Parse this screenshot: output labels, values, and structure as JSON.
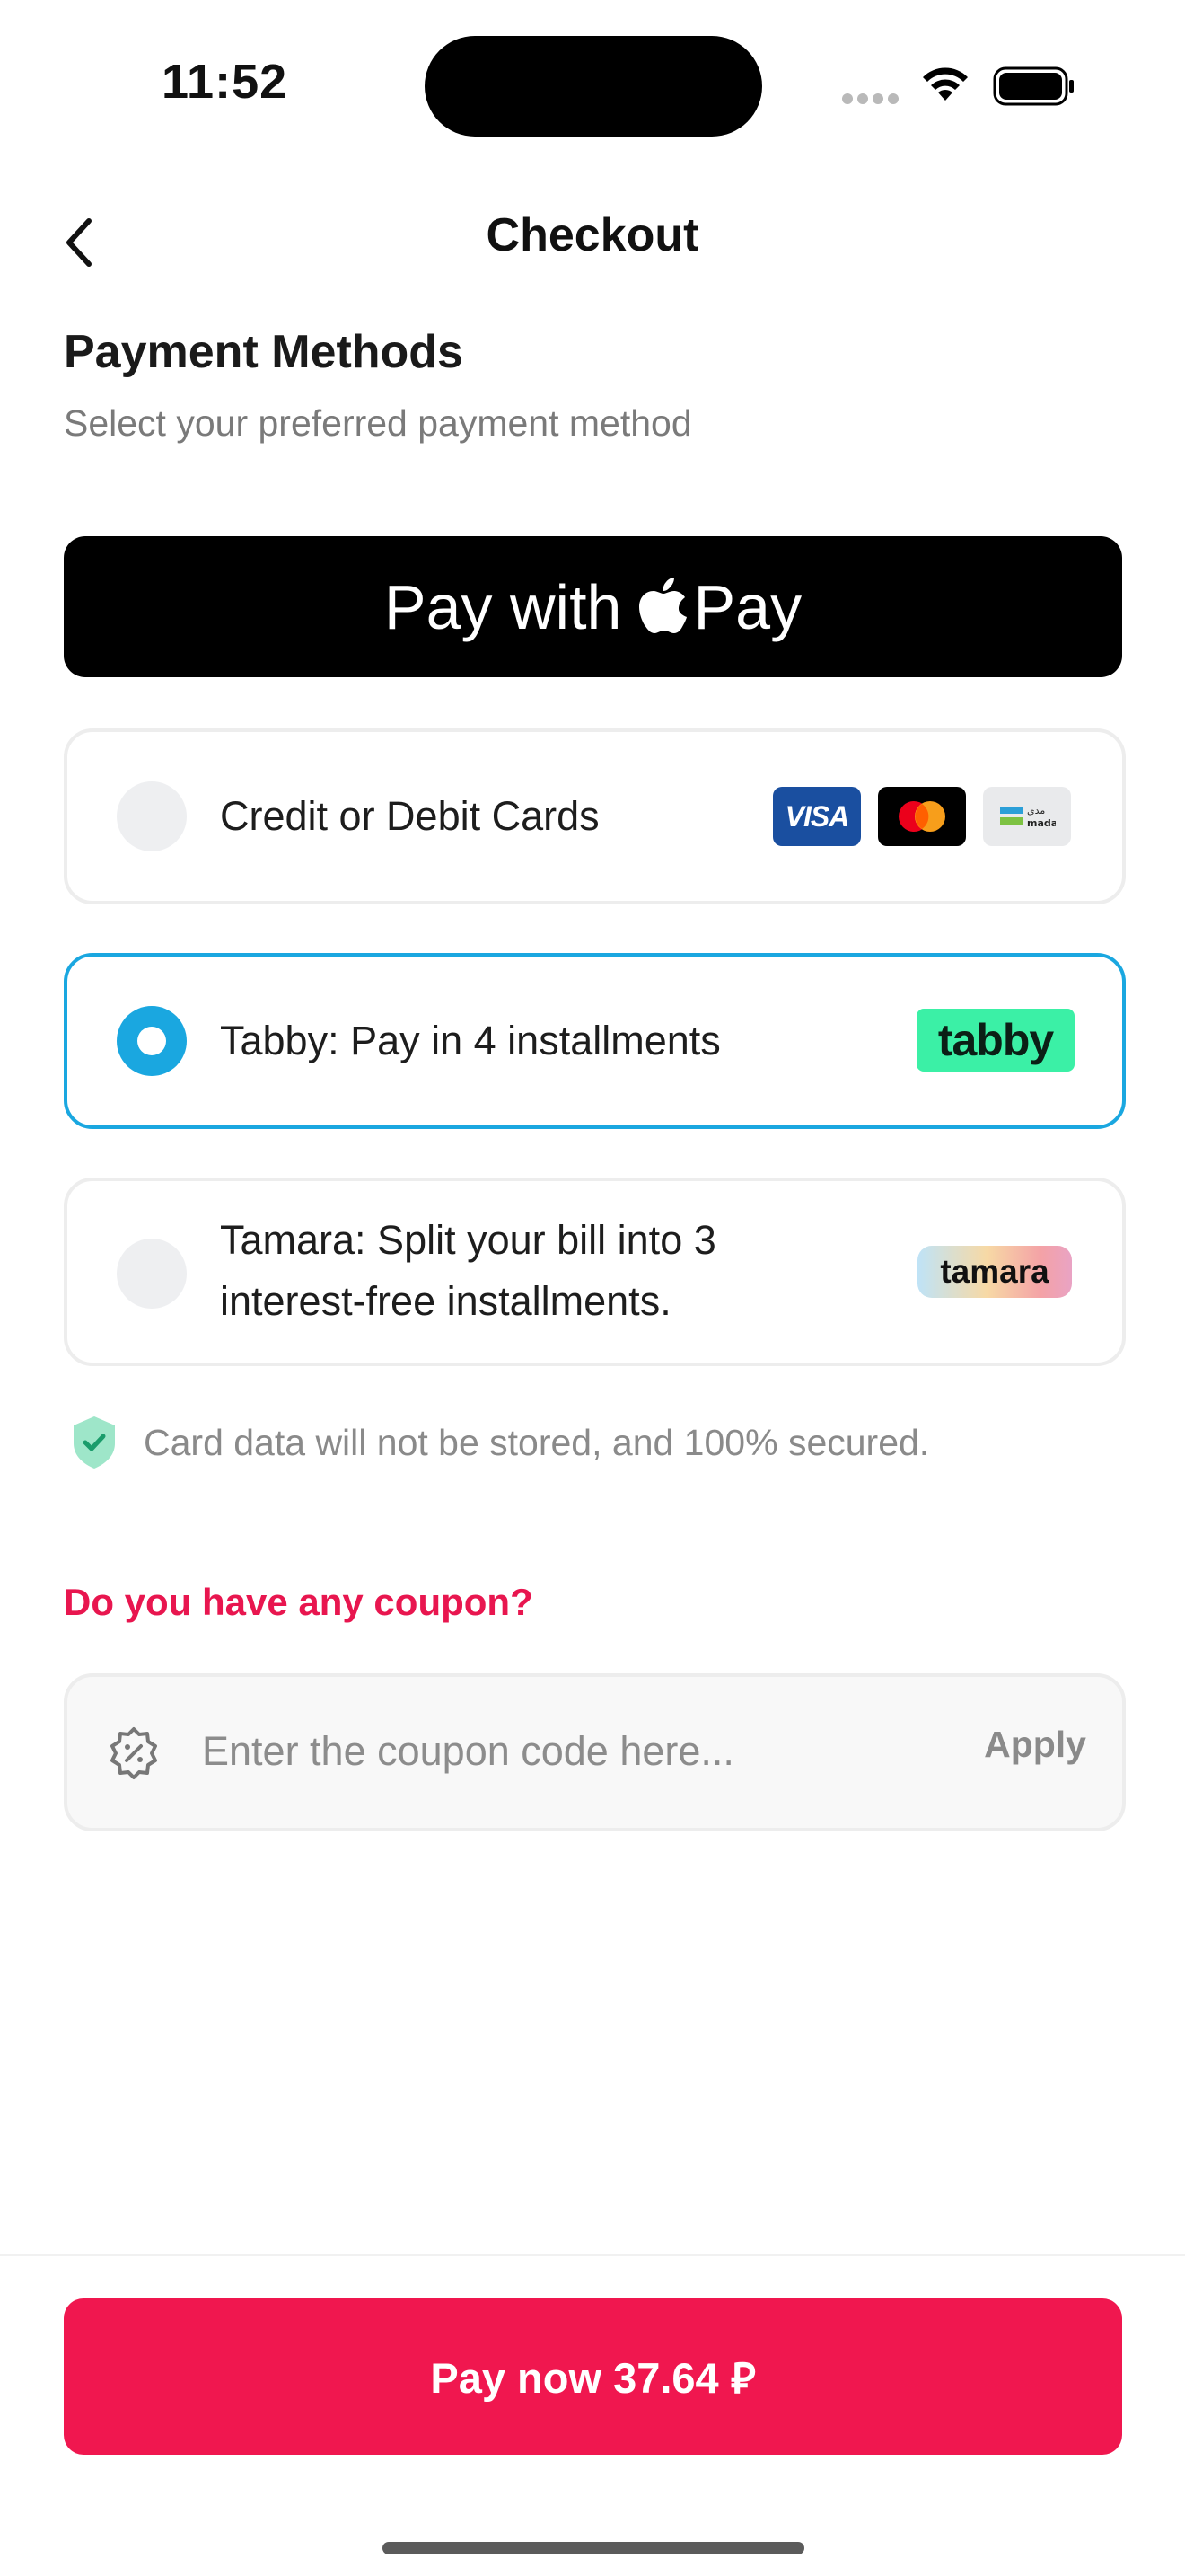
{
  "status_bar": {
    "time": "11:52",
    "wifi_icon": "wifi-icon",
    "battery_icon": "battery-icon"
  },
  "header": {
    "back_icon": "chevron-left-icon",
    "title": "Checkout"
  },
  "payment": {
    "title": "Payment Methods",
    "subtitle": "Select your preferred payment method",
    "apple_pay": {
      "prefix": "Pay with",
      "brand": "Pay"
    },
    "options": [
      {
        "label": "Credit or Debit Cards",
        "selected": false,
        "logos": [
          "VISA",
          "mastercard",
          "mada"
        ]
      },
      {
        "label": "Tabby: Pay in 4 installments",
        "selected": true,
        "badge": "tabby"
      },
      {
        "label_line1": "Tamara: Split your bill into 3",
        "label_line2": "interest-free installments.",
        "selected": false,
        "badge": "tamara"
      }
    ],
    "secure_note": "Card data will not be stored, and 100% secured."
  },
  "coupon": {
    "question": "Do you have any coupon?",
    "placeholder": "Enter the coupon code here...",
    "value": "",
    "apply_label": "Apply",
    "icon": "discount-badge-icon"
  },
  "footer": {
    "pay_label": "Pay now 37.64 ⃁"
  },
  "colors": {
    "accent": "#f0174f",
    "selected_border": "#1aa7e0",
    "tabby_green": "#3bf0a6",
    "secure_green": "#9ee6c9"
  }
}
